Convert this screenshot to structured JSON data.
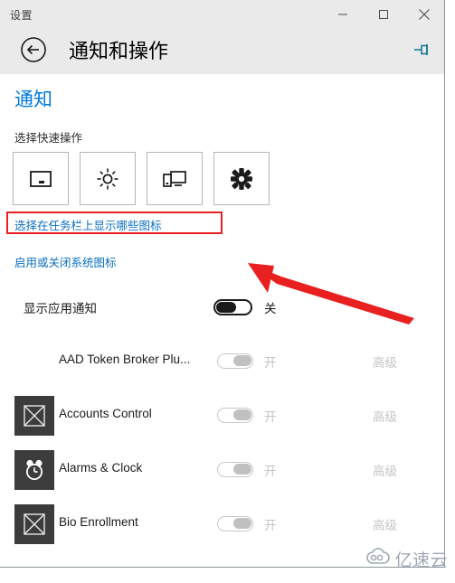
{
  "window": {
    "title": "设置",
    "controls": {
      "minimize": "minimize-icon",
      "maximize": "maximize-icon",
      "close": "close-icon"
    }
  },
  "header": {
    "back_icon": "back-arrow-icon",
    "page_title": "通知和操作",
    "pin_icon": "pin-icon",
    "pin_color": "#1b7b94"
  },
  "content": {
    "section_heading": "通知",
    "section_heading_color": "#0078d7",
    "quick_actions_label": "选择快速操作",
    "tiles": [
      {
        "name": "tablet-note-icon",
        "label": ""
      },
      {
        "name": "brightness-sun-icon",
        "label": ""
      },
      {
        "name": "connect-display-icon",
        "label": ""
      },
      {
        "name": "settings-gear-icon",
        "label": ""
      }
    ],
    "links": [
      {
        "text": "选择在任务栏上显示哪些图标",
        "highlighted": true
      },
      {
        "text": "启用或关闭系统图标",
        "highlighted": false
      }
    ],
    "link_color": "#0a6fc2",
    "master_toggle": {
      "label": "显示应用通知",
      "state": "关",
      "on": false
    },
    "apps": [
      {
        "name": "AAD Token Broker Plu...",
        "icon": "none",
        "state": "开",
        "on": true,
        "advanced": "高级"
      },
      {
        "name": "Accounts Control",
        "icon": "placeholder-x-icon",
        "state": "开",
        "on": true,
        "advanced": "高级"
      },
      {
        "name": "Alarms & Clock",
        "icon": "alarm-clock-icon",
        "state": "开",
        "on": true,
        "advanced": "高级"
      },
      {
        "name": "Bio Enrollment",
        "icon": "placeholder-x-icon",
        "state": "开",
        "on": true,
        "advanced": "高级"
      }
    ]
  },
  "annotations": {
    "red_color": "#e8201f",
    "box_target": "选择在任务栏上显示哪些图标",
    "arrow": "red-arrow-pointing-up-left"
  },
  "watermark": {
    "text": "亿速云",
    "icon": "cloud-logo-icon"
  }
}
